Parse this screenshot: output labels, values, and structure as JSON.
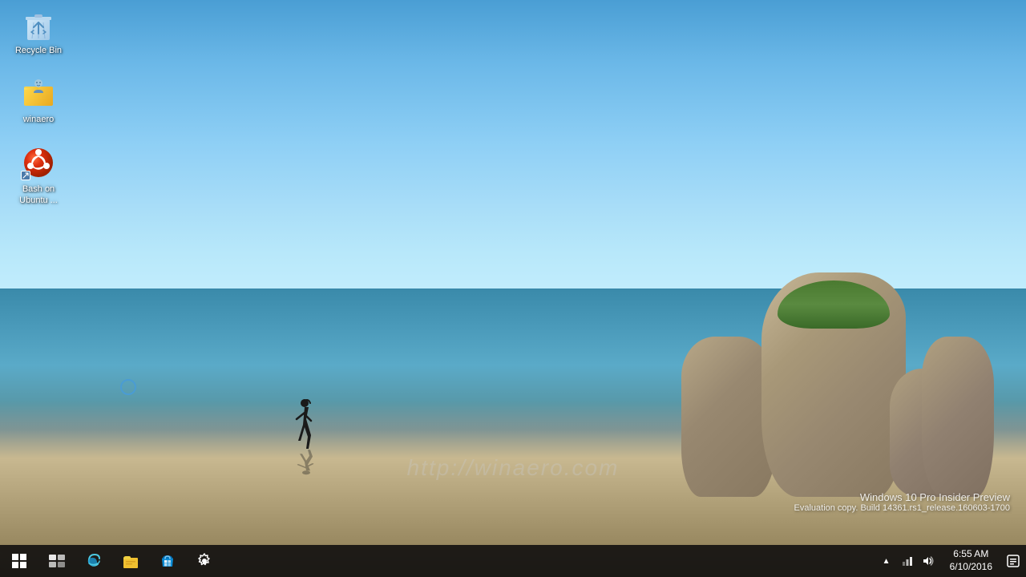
{
  "desktop": {
    "background_description": "Windows 10 beach wallpaper with ocean, rocks, and runner"
  },
  "icons": [
    {
      "id": "recycle-bin",
      "label": "Recycle Bin",
      "type": "recycle-bin"
    },
    {
      "id": "winaero",
      "label": "winaero",
      "type": "folder-person"
    },
    {
      "id": "bash-ubuntu",
      "label": "Bash on Ubuntu ...",
      "type": "ubuntu"
    }
  ],
  "watermark": {
    "text": "http://winaero.com"
  },
  "eval_text": {
    "line1": "Windows 10 Pro Insider Preview",
    "line2": "Evaluation copy. Build 14361.rs1_release.160603-1700"
  },
  "taskbar": {
    "start_label": "Start",
    "items": [
      {
        "id": "task-view",
        "label": "Task View",
        "icon": "task-view-icon"
      },
      {
        "id": "edge",
        "label": "Microsoft Edge",
        "icon": "edge-icon"
      },
      {
        "id": "file-explorer",
        "label": "File Explorer",
        "icon": "folder-icon"
      },
      {
        "id": "store",
        "label": "Microsoft Store",
        "icon": "store-icon"
      },
      {
        "id": "settings",
        "label": "Settings",
        "icon": "settings-icon"
      }
    ],
    "tray": {
      "show_hidden": "^",
      "network": "network-icon",
      "volume": "volume-icon",
      "time": "6:55 AM",
      "date": "6/10/2016",
      "notification": "notification-icon"
    }
  }
}
